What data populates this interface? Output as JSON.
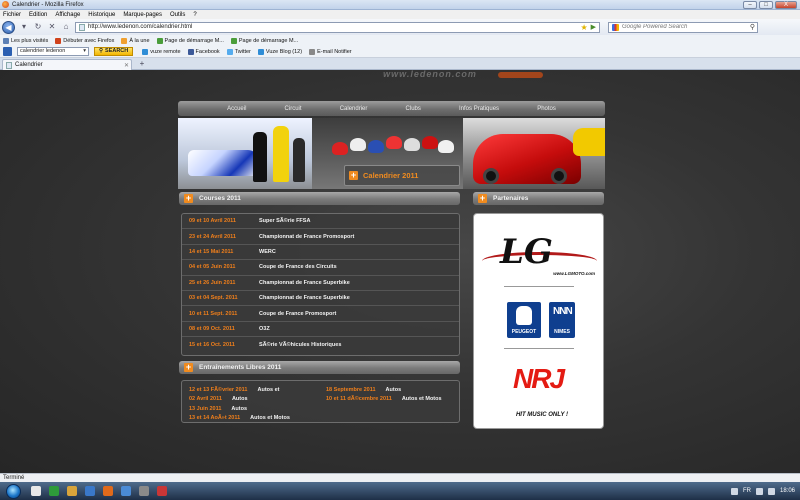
{
  "window": {
    "title": "Calendrier - Mozilla Firefox",
    "controls": {
      "minimize": "–",
      "maximize": "□",
      "close": "X"
    }
  },
  "menu": [
    "Fichier",
    "Edition",
    "Affichage",
    "Historique",
    "Marque-pages",
    "Outils",
    "?"
  ],
  "nav": {
    "url": "http://www.ledenon.com/calendrier.html",
    "search_placeholder": "Google Powered Search"
  },
  "bookmarks": [
    {
      "label": "Les plus visités",
      "color": "#5b7fb5"
    },
    {
      "label": "Débuter avec Firefox",
      "color": "#d0421b"
    },
    {
      "label": "À la une",
      "color": "#f0a030"
    },
    {
      "label": "Page de démarrage M...",
      "color": "#4a9d3a"
    },
    {
      "label": "Page de démarrage M...",
      "color": "#4a9d3a"
    }
  ],
  "toolbar2": {
    "search_value": "calendrier ledenon",
    "search_button": "SEARCH",
    "items": [
      {
        "label": "vuze remote",
        "color": "#2f8dd6"
      },
      {
        "label": "Facebook",
        "color": "#3b5998"
      },
      {
        "label": "Twitter",
        "color": "#55acee"
      },
      {
        "label": "Vuze Blog (12)",
        "color": "#2f8dd6"
      },
      {
        "label": "E-mail Notifier",
        "color": "#888888"
      }
    ]
  },
  "tab": {
    "label": "Calendrier"
  },
  "site": {
    "logo_text": "www.ledenon.com",
    "nav": [
      "Accueil",
      "Circuit",
      "Calendrier",
      "Clubs",
      "Infos Pratiques",
      "Photos"
    ],
    "banner_label": "Calendrier 2011",
    "races_title": "Courses 2011",
    "races": [
      {
        "date": "09 et 10 Avril 2011",
        "name": "Super SÃ©rie FFSA"
      },
      {
        "date": "23 et 24 Avril 2011",
        "name": "Championnat de France Promosport"
      },
      {
        "date": "14 et 15 Mai 2011",
        "name": "WERC"
      },
      {
        "date": "04 et 05 Juin 2011",
        "name": "Coupe de France des Circuits"
      },
      {
        "date": "25 et 26 Juin 2011",
        "name": "Championnat de France Superbike"
      },
      {
        "date": "03 et 04 Sept. 2011",
        "name": "Championnat de France Superbike"
      },
      {
        "date": "10 et 11 Sept. 2011",
        "name": "Coupe de France Promosport"
      },
      {
        "date": "08 et 09 Oct. 2011",
        "name": "O3Z"
      },
      {
        "date": "15 et 16 Oct. 2011",
        "name": "SÃ©rie VÃ©hicules Historiques"
      }
    ],
    "training_title": "Entraînements Libres 2011",
    "training_left": [
      {
        "date": "12 et 13 FÃ©vrier 2011",
        "type": "Autos et"
      },
      {
        "date": "02 Avril 2011",
        "type": "Autos"
      },
      {
        "date": "13 Juin 2011",
        "type": "Autos"
      },
      {
        "date": "13 et 14 AoÃ»t 2011",
        "type": "Autos et Motos"
      }
    ],
    "training_right": [
      {
        "date": "18 Septembre 2011",
        "type": "Autos"
      },
      {
        "date": "10 et 11 dÃ©cembre 2011",
        "type": "Autos et Motos"
      }
    ],
    "partners_title": "Partenaires",
    "partners": {
      "lg_logo": "LG",
      "lg_site": "www.LGMOTO.com",
      "peugeot": "PEUGEOT",
      "nimes_mark": "NNN",
      "nimes": "NIMES",
      "nrj": "NRJ",
      "nrj_tagline": "HIT MUSIC ONLY !"
    }
  },
  "status": {
    "text": "Terminé"
  },
  "taskbar": {
    "tray_lang": "FR",
    "clock": "18:06",
    "apps": [
      "#e8e8e8",
      "#2e9b3a",
      "#d9a43b",
      "#3a78c9",
      "#e06a1b",
      "#4a8bd6",
      "#8a8a8a",
      "#c93636"
    ]
  }
}
